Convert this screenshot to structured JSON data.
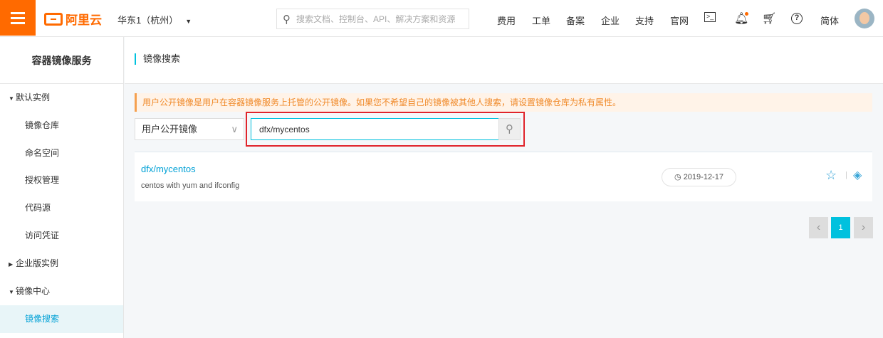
{
  "header": {
    "logo": "阿里云",
    "region": "华东1（杭州）",
    "search_placeholder": "搜索文档、控制台、API、解决方案和资源",
    "nav": [
      "费用",
      "工单",
      "备案",
      "企业",
      "支持",
      "官网"
    ],
    "language": "简体"
  },
  "sidebar": {
    "title": "容器镜像服务",
    "items": [
      {
        "label": "默认实例",
        "type": "group",
        "expanded": true
      },
      {
        "label": "镜像仓库"
      },
      {
        "label": "命名空间"
      },
      {
        "label": "授权管理"
      },
      {
        "label": "代码源"
      },
      {
        "label": "访问凭证"
      },
      {
        "label": "企业版实例",
        "type": "group",
        "expanded": false
      },
      {
        "label": "镜像中心",
        "type": "group",
        "expanded": true
      },
      {
        "label": "镜像搜索",
        "active": true
      }
    ]
  },
  "main": {
    "title": "镜像搜索",
    "notice": "用户公开镜像是用户在容器镜像服务上托管的公开镜像。如果您不希望自己的镜像被其他人搜索，请设置镜像仓库为私有属性。",
    "scope": "用户公开镜像",
    "query": "dfx/mycentos",
    "results": [
      {
        "name": "dfx/mycentos",
        "description": "centos with yum and ifconfig",
        "date": "2019-12-17"
      }
    ],
    "pagination": {
      "current": "1"
    }
  },
  "colors": {
    "brand": "#ff6a00",
    "accent": "#00c1de",
    "highlight": "#e0242b"
  }
}
